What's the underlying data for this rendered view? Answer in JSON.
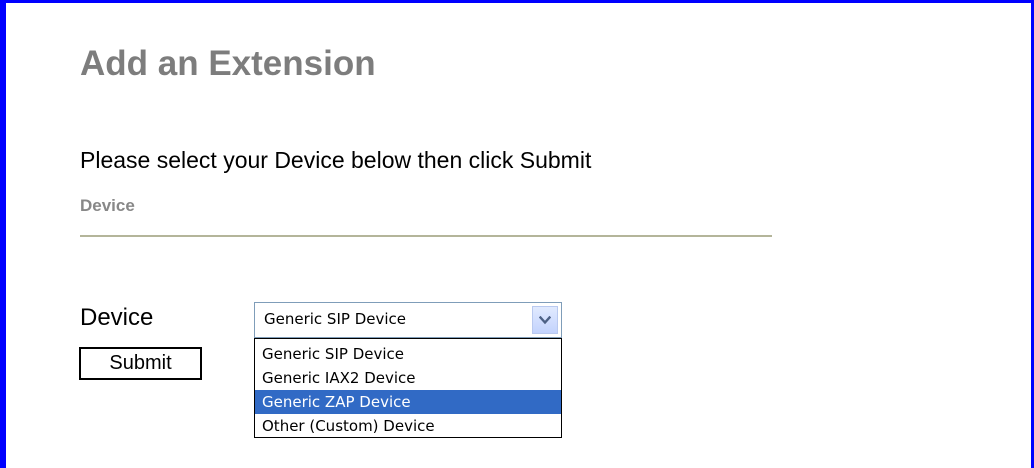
{
  "page": {
    "title": "Add an Extension",
    "instruction": "Please select your Device below then click Submit",
    "section_heading": "Device"
  },
  "form": {
    "device_label": "Device",
    "submit_label": "Submit",
    "device_select": {
      "selected": "Generic SIP Device",
      "options": [
        "Generic SIP Device",
        "Generic IAX2 Device",
        "Generic ZAP Device",
        "Other (Custom) Device"
      ],
      "highlighted_option": "Generic ZAP Device"
    }
  },
  "colors": {
    "frame_border": "#0000ff",
    "title_text": "#7d7d7d",
    "highlight_bg": "#316ac5"
  },
  "icons": {
    "select_arrow": "chevron-down-icon"
  }
}
